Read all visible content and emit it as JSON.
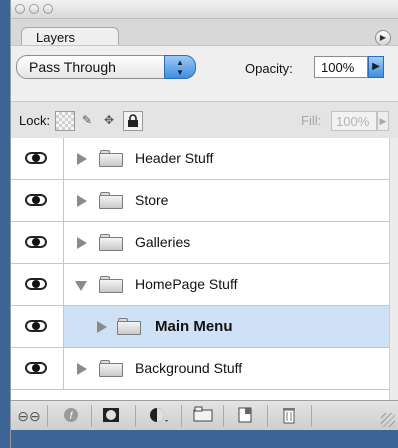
{
  "panel": {
    "tab_label": "Layers",
    "blend_mode": "Pass Through",
    "opacity_label": "Opacity:",
    "opacity_value": "100%",
    "lock_label": "Lock:",
    "fill_label": "Fill:",
    "fill_value": "100%"
  },
  "layers": [
    {
      "name": "Header Stuff",
      "expanded": false,
      "visible": true,
      "selected": false,
      "indent": 0
    },
    {
      "name": "Store",
      "expanded": false,
      "visible": true,
      "selected": false,
      "indent": 0
    },
    {
      "name": "Galleries",
      "expanded": false,
      "visible": true,
      "selected": false,
      "indent": 0
    },
    {
      "name": "HomePage Stuff",
      "expanded": true,
      "visible": true,
      "selected": false,
      "indent": 0
    },
    {
      "name": "Main Menu",
      "expanded": false,
      "visible": false,
      "selected": true,
      "indent": 1
    },
    {
      "name": "Background Stuff",
      "expanded": false,
      "visible": true,
      "selected": false,
      "indent": 0
    }
  ],
  "icons": {
    "panel_menu": "panel-menu-icon",
    "blend_stepper": "up-down-arrows-icon",
    "opacity_arrow": "triangle-right-icon",
    "lock_transparent": "checker-icon",
    "lock_image": "brush-icon",
    "lock_position": "move-icon",
    "lock_all": "padlock-icon",
    "link": "link-icon",
    "styles": "fx-icon",
    "mask": "mask-icon",
    "adjustment": "half-circle-icon",
    "new_group": "folder-icon",
    "new_layer": "new-layer-icon",
    "delete": "trash-icon"
  },
  "colors": {
    "selection": "#cfe1f7",
    "aqua_blue": "#3d8ee1",
    "desktop": "#3d6497"
  }
}
